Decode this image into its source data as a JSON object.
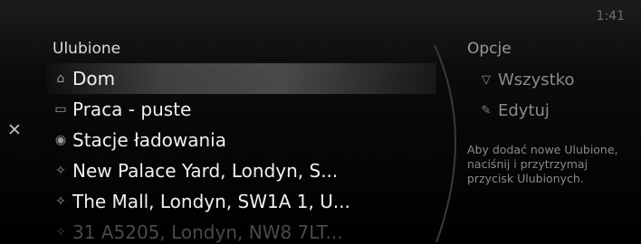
{
  "status": {
    "time": "1:41"
  },
  "favorites": {
    "title": "Ulubione",
    "items": [
      {
        "label": "Dom",
        "icon": "home-icon"
      },
      {
        "label": "Praca - puste",
        "icon": "briefcase-icon"
      },
      {
        "label": "Stacje ładowania",
        "icon": "pin-icon"
      },
      {
        "label": "New Palace Yard, Londyn, S...",
        "icon": "star-icon"
      },
      {
        "label": "The Mall, Londyn, SW1A 1, U...",
        "icon": "star-icon"
      },
      {
        "label": "31 A5205, Londyn, NW8 7LT...",
        "icon": "star-icon"
      }
    ]
  },
  "options": {
    "title": "Opcje",
    "items": [
      {
        "label": "Wszystko",
        "icon": "filter-icon"
      },
      {
        "label": "Edytuj",
        "icon": "pencil-icon"
      }
    ],
    "hint": "Aby dodać nowe Ulubione, naciśnij i przytrzymaj przycisk Ulubionych."
  },
  "colors": {
    "background": "#000000",
    "text": "#f0f0f0",
    "dim": "#8a8a8a"
  }
}
